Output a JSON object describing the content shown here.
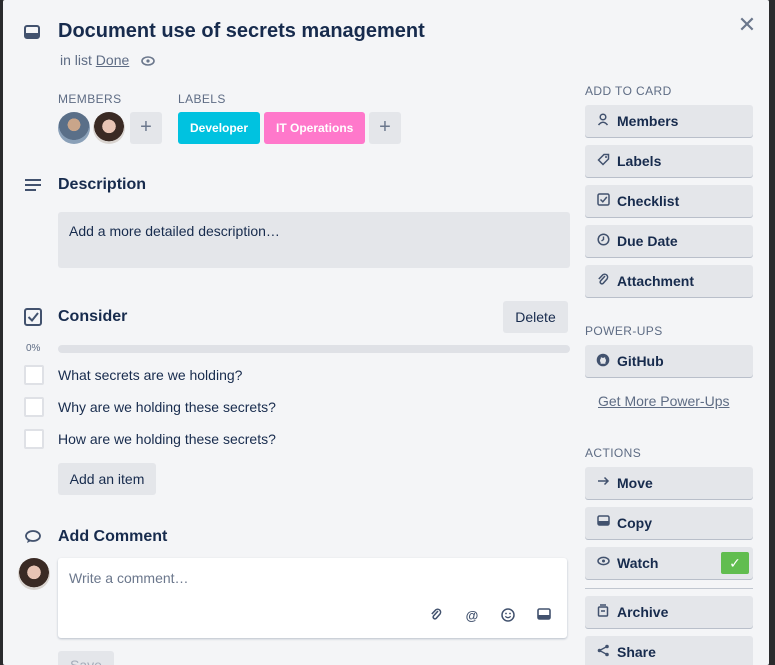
{
  "card": {
    "title": "Document use of secrets management",
    "in_list_prefix": "in list",
    "list_name": "Done"
  },
  "members": {
    "heading": "MEMBERS"
  },
  "labels": {
    "heading": "LABELS",
    "items": [
      {
        "text": "Developer",
        "color": "#00c2e0"
      },
      {
        "text": "IT Operations",
        "color": "#ff78cb"
      }
    ]
  },
  "description": {
    "heading": "Description",
    "placeholder": "Add a more detailed description…"
  },
  "checklist": {
    "heading": "Consider",
    "delete_label": "Delete",
    "progress_text": "0%",
    "progress": 0,
    "items": [
      {
        "text": "What secrets are we holding?"
      },
      {
        "text": "Why are we holding these secrets?"
      },
      {
        "text": "How are we holding these secrets?"
      }
    ],
    "add_item_label": "Add an item"
  },
  "comment": {
    "heading": "Add Comment",
    "placeholder": "Write a comment…",
    "save_label": "Save"
  },
  "sidebar": {
    "add_to_card": {
      "heading": "ADD TO CARD",
      "buttons": [
        "Members",
        "Labels",
        "Checklist",
        "Due Date",
        "Attachment"
      ]
    },
    "power_ups": {
      "heading": "POWER-UPS",
      "buttons": [
        "GitHub"
      ],
      "more_link": "Get More Power-Ups"
    },
    "actions": {
      "heading": "ACTIONS",
      "buttons": [
        "Move",
        "Copy",
        "Watch",
        "Archive",
        "Share"
      ],
      "watch_active": true
    }
  },
  "colors": {
    "accent_green": "#61bd4f",
    "label_blue": "#00c2e0",
    "label_pink": "#ff78cb"
  }
}
